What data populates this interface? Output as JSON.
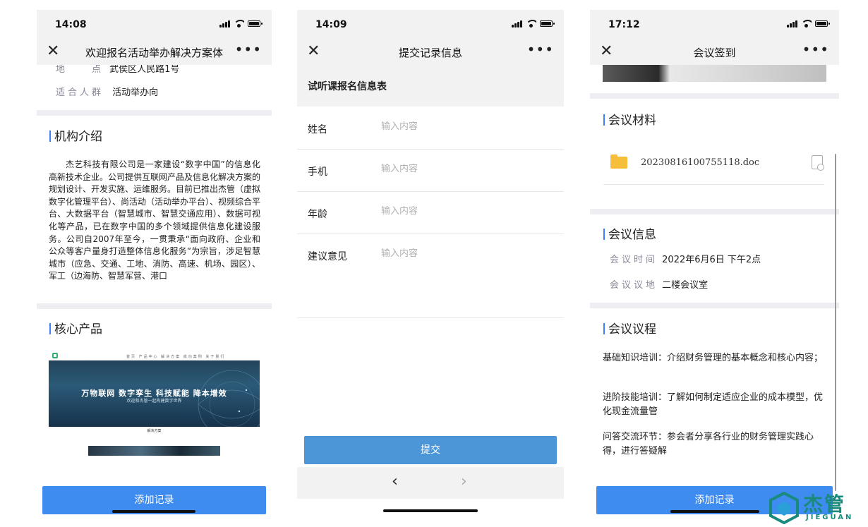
{
  "phone1": {
    "time": "14:08",
    "title": "欢迎报名活动举办解决方案体",
    "address_label": "地　　点",
    "address_value": "武侯区人民路1号",
    "audience_label": "适合人群",
    "audience_value": "活动举办向",
    "org_title": "机构介绍",
    "org_text": "杰艺科技有限公司是一家建设“数字中国”的信息化高新技术企业。公司提供互联网产品及信息化解决方案的规划设计、开发实施、运维服务。目前已推出杰管（虚拟数字化管理平台）、尚活动（活动举办平台）、视频综合平台、大数据平台（智慧城市、智慧交通应用）、数据可视化等产品，已在数字中国的多个领域提供信息化建设服务。公司自2007年至今，一贯秉承“面向政府、企业和公众等客户量身打造整体信息化服务”为宗旨，涉足智慧城市（应急、交通、工地、消防、高速、机场、园区）、军工（边海防、智慧军营、港口",
    "products_title": "核心产品",
    "banner_headline": "万物联网  数字孪生  科技赋能  降本增效",
    "banner_sub": "欢迎和杰管一起构建数字世界",
    "banner_nav": "首页  产品中心  解决方案  成功案例  关于我们",
    "banner2_title": "解决方案",
    "add_button": "添加记录"
  },
  "phone2": {
    "time": "14:09",
    "title": "提交记录信息",
    "form_heading": "试听课报名信息表",
    "fields": [
      {
        "label": "姓名",
        "placeholder": "输入内容"
      },
      {
        "label": "手机",
        "placeholder": "输入内容"
      },
      {
        "label": "年龄",
        "placeholder": "输入内容"
      },
      {
        "label": "建议意见",
        "placeholder": "输入内容"
      }
    ],
    "submit": "提交",
    "back": "‹",
    "forward": "›"
  },
  "phone3": {
    "time": "17:12",
    "title": "会议签到",
    "materials_title": "会议材料",
    "file_name": "20230816100755118.doc",
    "info_title": "会议信息",
    "time_label": "会议时间",
    "time_value": "2022年6月6日 下午2点",
    "place_label": "会议议地",
    "place_value": "二楼会议室",
    "agenda_title": "会议议程",
    "agenda": [
      "基础知识培训：介绍财务管理的基本概念和核心内容；",
      "进阶技能培训：了解如何制定适应企业的成本模型，优化现金流量管",
      "问答交流环节：参会者分享各行业的财务管理实践心得，进行答疑解"
    ],
    "add_button": "添加记录"
  },
  "logo": {
    "name": "杰管",
    "sub": "JIEGUAN",
    "color": "#1a8a7c"
  },
  "colors": {
    "accent": "#3f8cf0",
    "bar": "#3b82f6"
  }
}
